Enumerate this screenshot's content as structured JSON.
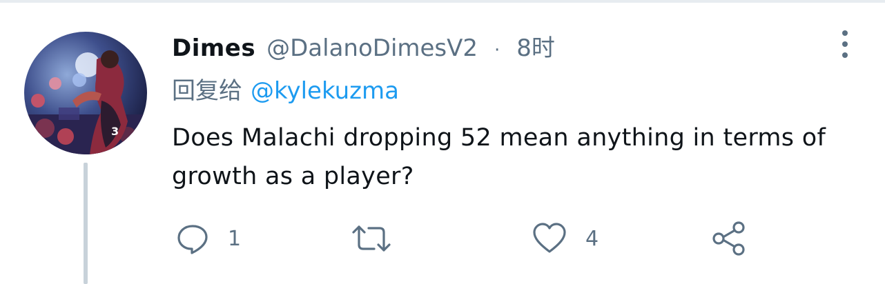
{
  "tweet": {
    "display_name": "Dimes",
    "handle": "@DalanoDimesV2",
    "separator": "·",
    "time": "8时",
    "reply_prefix": "回复给",
    "reply_to": "@kylekuzma",
    "text": "Does Malachi dropping 52 mean anything in terms of growth as a player?",
    "actions": {
      "reply_count": "1",
      "retweet_count": "",
      "like_count": "4",
      "reply_icon": "speech-bubble-icon",
      "retweet_icon": "retweet-arrows-icon",
      "like_icon": "heart-icon",
      "share_icon": "share-nodes-icon"
    }
  },
  "colors": {
    "primary_text": "#0f1419",
    "secondary_text": "#5b7083",
    "link": "#1d9bf0",
    "thread_line": "#c8d2da"
  }
}
